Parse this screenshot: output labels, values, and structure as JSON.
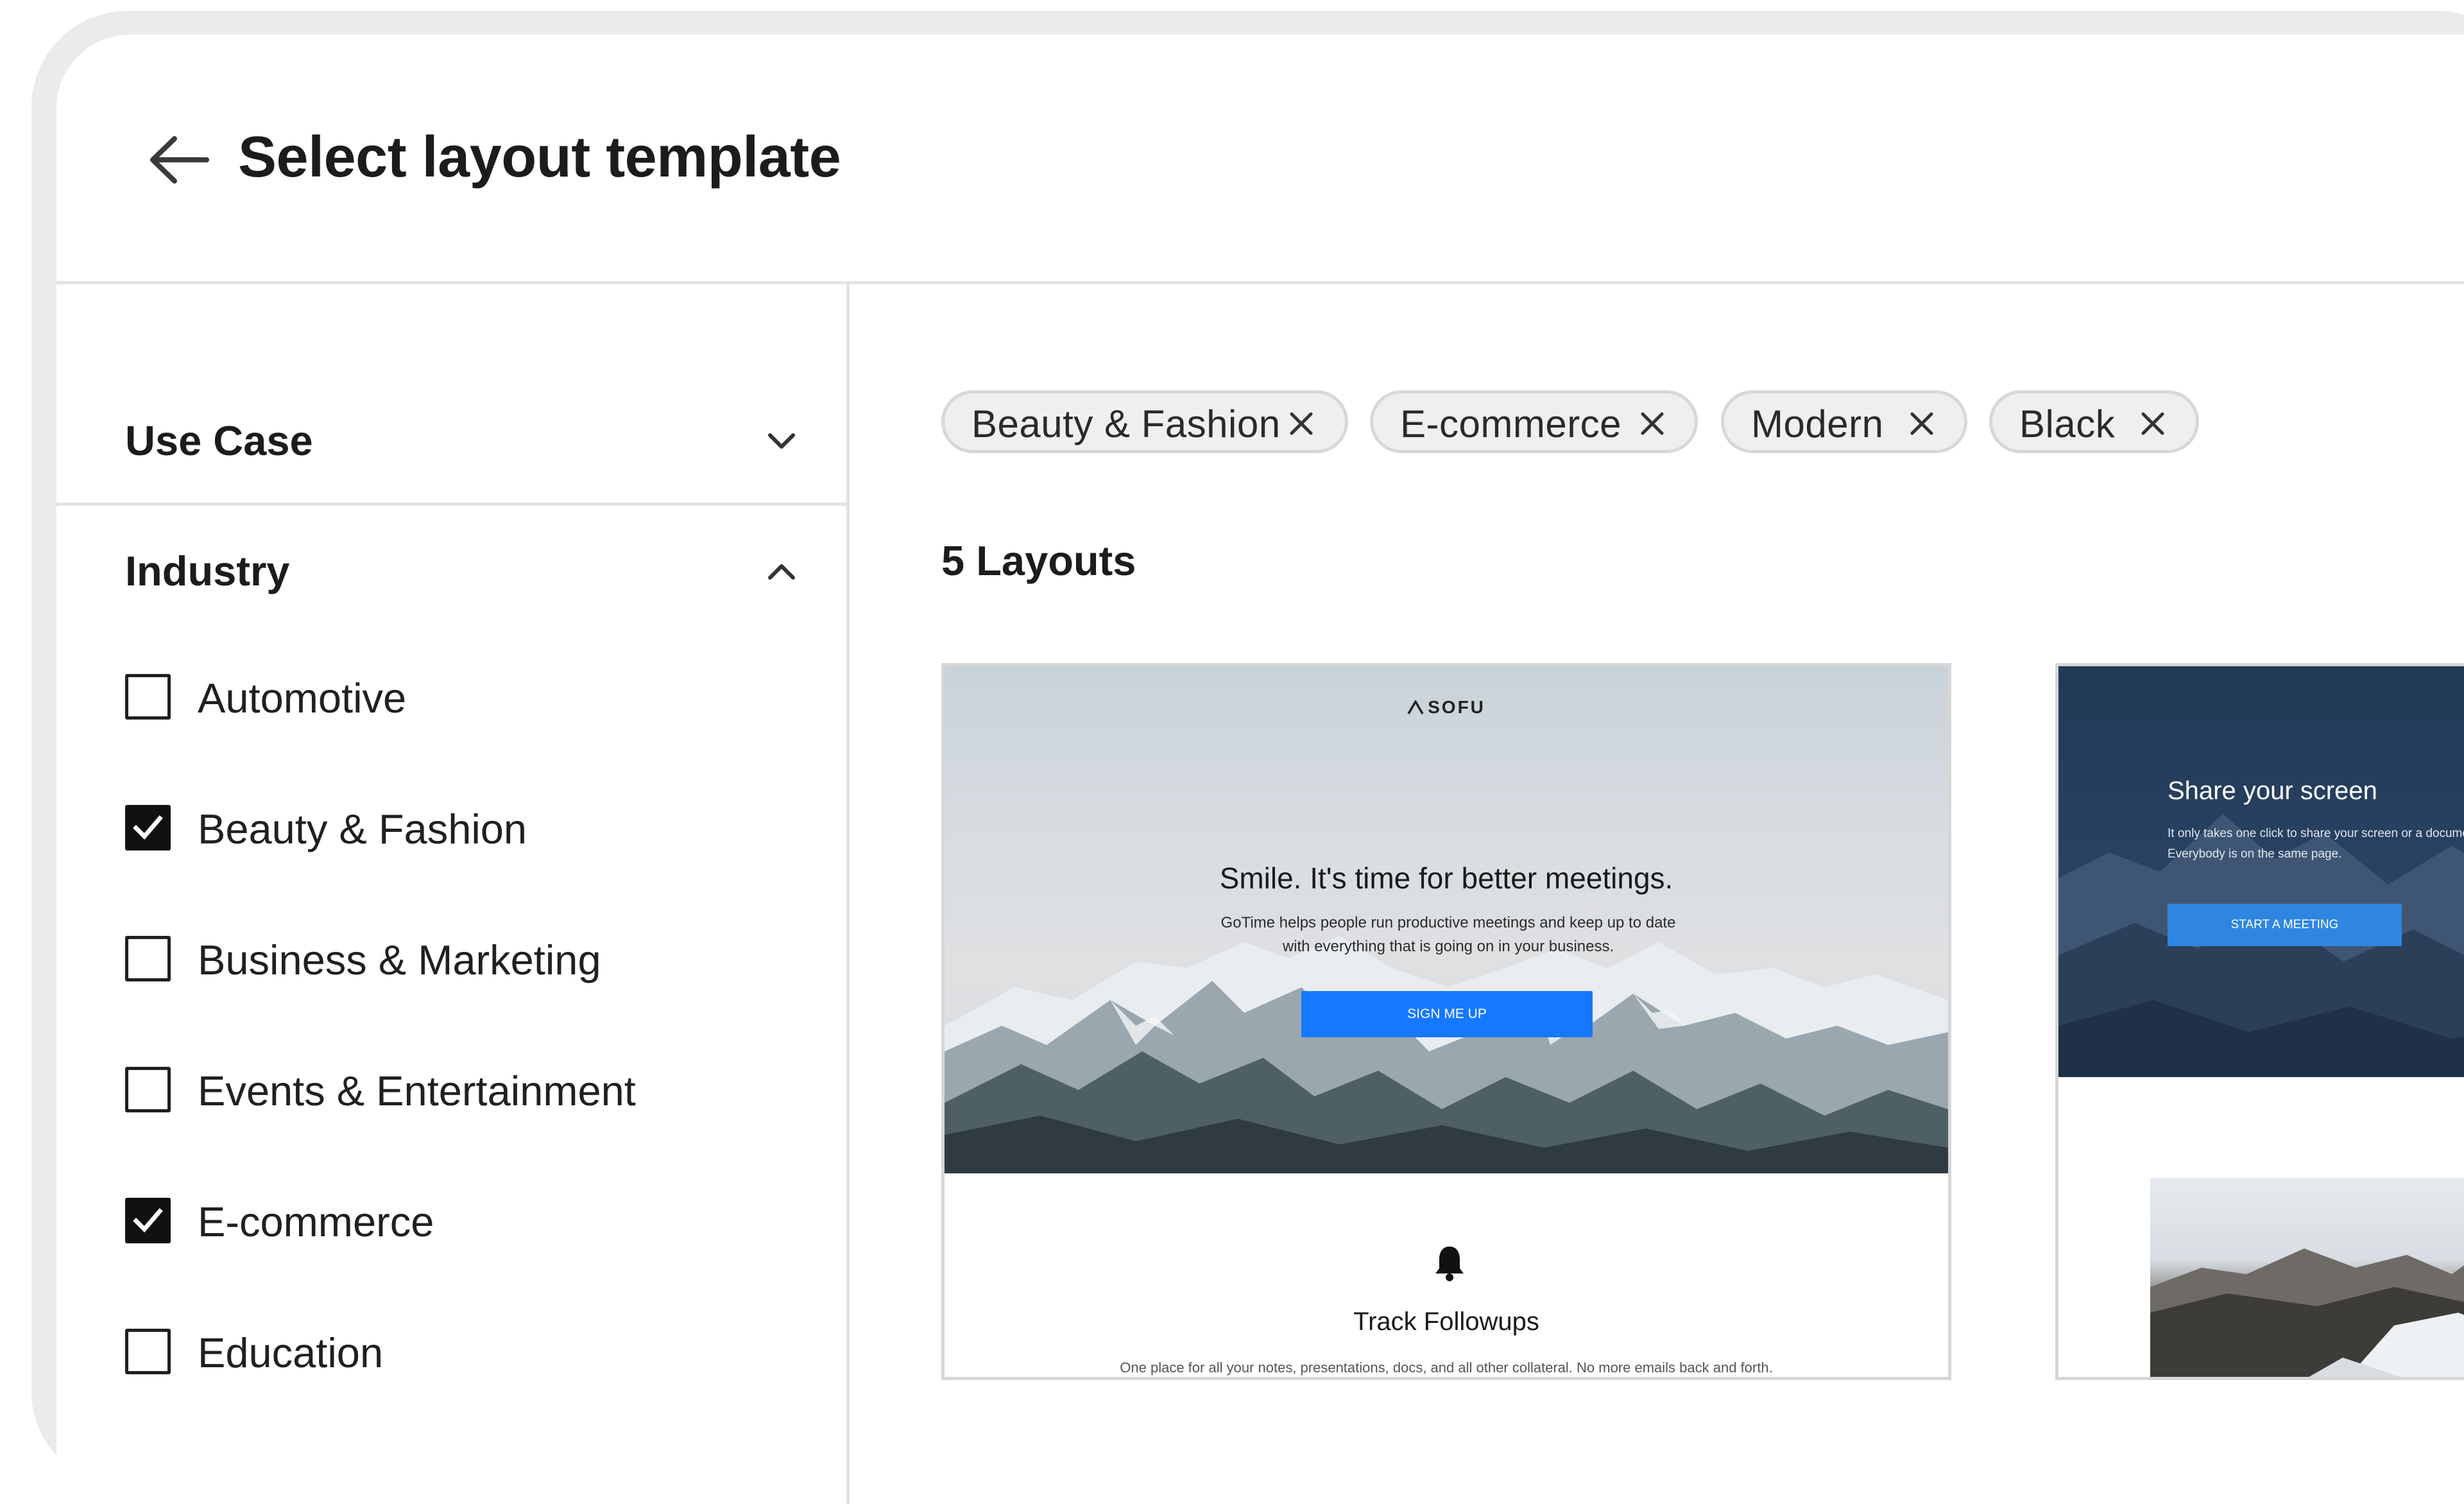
{
  "header": {
    "title": "Select layout template"
  },
  "sidebar": {
    "use_case": {
      "title": "Use Case"
    },
    "industry": {
      "title": "Industry",
      "options": [
        {
          "label": "Automotive",
          "checked": false
        },
        {
          "label": "Beauty & Fashion",
          "checked": true
        },
        {
          "label": "Business & Marketing",
          "checked": false
        },
        {
          "label": "Events & Entertainment",
          "checked": false
        },
        {
          "label": "E-commerce",
          "checked": true
        },
        {
          "label": "Education",
          "checked": false
        }
      ]
    }
  },
  "filters": {
    "chips": [
      {
        "label": "Beauty & Fashion"
      },
      {
        "label": "E-commerce"
      },
      {
        "label": "Modern"
      },
      {
        "label": "Black"
      }
    ]
  },
  "results": {
    "count_label": "5 Layouts"
  },
  "templates": [
    {
      "logo": "SOFU",
      "hero_title": "Smile. It's time for better meetings.",
      "hero_text": "GoTime helps people run productive meetings and keep up to date with everything that is going on in your business.",
      "button": "SIGN ME UP",
      "feature_icon": "bell-icon",
      "feature_title": "Track Followups",
      "feature_text": "One place for all your notes, presentations, docs, and all other collateral. No more emails back and forth."
    },
    {
      "hero_title": "Share your screen",
      "hero_text": "It only takes one click to share your screen or a document. Everybody is on the same page.",
      "button": "START A MEETING"
    }
  ],
  "colors": {
    "primary_button": "#1677ff",
    "dark_hero": "#223955",
    "checkbox_checked": "#111111",
    "chip_background": "#efefef"
  },
  "icons": {
    "back": "arrow-left-icon",
    "collapse": "chevron-down-icon",
    "expand": "chevron-up-icon",
    "remove": "close-icon",
    "check": "checkmark-icon"
  }
}
